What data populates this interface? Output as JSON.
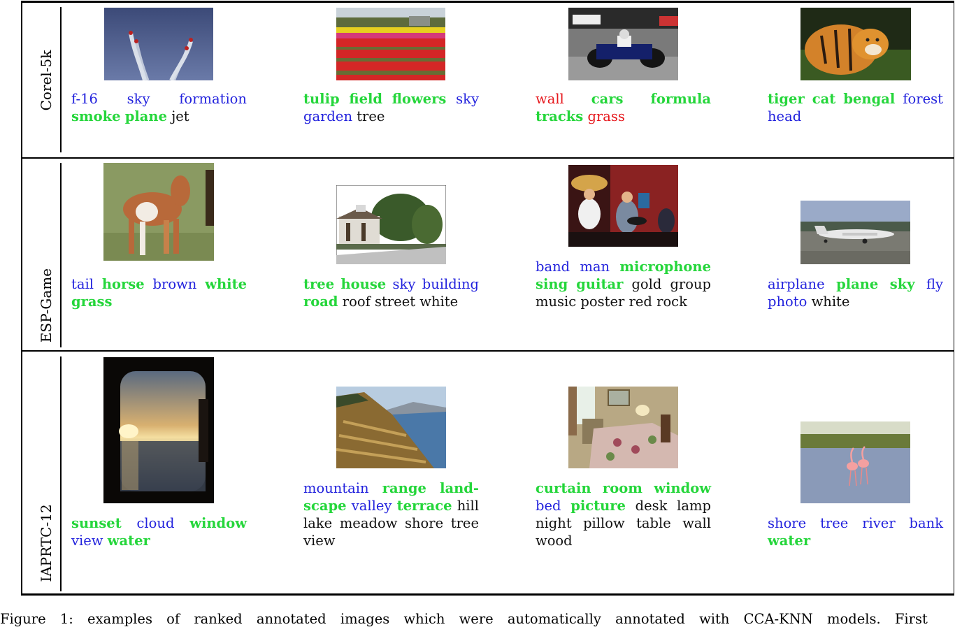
{
  "rows": [
    {
      "label": "Corel-5k",
      "cells": [
        {
          "image": "airshow-jets-photo",
          "tags": [
            {
              "text": "f-16",
              "status": "blue"
            },
            {
              "text": "sky",
              "status": "blue"
            },
            {
              "text": "formation",
              "status": "blue"
            },
            {
              "text": "smoke",
              "status": "green"
            },
            {
              "text": "plane",
              "status": "green"
            },
            {
              "text": "jet",
              "status": "black"
            }
          ]
        },
        {
          "image": "tulip-field-photo",
          "tags": [
            {
              "text": "tulip",
              "status": "green"
            },
            {
              "text": "field",
              "status": "green"
            },
            {
              "text": "flowers",
              "status": "green"
            },
            {
              "text": "sky",
              "status": "blue"
            },
            {
              "text": "garden",
              "status": "blue"
            },
            {
              "text": "tree",
              "status": "black"
            }
          ]
        },
        {
          "image": "formula-car-photo",
          "tags": [
            {
              "text": "wall",
              "status": "red"
            },
            {
              "text": "cars",
              "status": "green"
            },
            {
              "text": "formula",
              "status": "green"
            },
            {
              "text": "tracks",
              "status": "green"
            },
            {
              "text": "grass",
              "status": "red"
            }
          ]
        },
        {
          "image": "tiger-photo",
          "tags": [
            {
              "text": "tiger",
              "status": "green"
            },
            {
              "text": "cat",
              "status": "green"
            },
            {
              "text": "bengal",
              "status": "green"
            },
            {
              "text": "forest",
              "status": "blue"
            },
            {
              "text": "head",
              "status": "blue"
            }
          ]
        }
      ]
    },
    {
      "label": "ESP-Game",
      "cells": [
        {
          "image": "pony-photo",
          "tags": [
            {
              "text": "tail",
              "status": "blue"
            },
            {
              "text": "horse",
              "status": "green"
            },
            {
              "text": "brown",
              "status": "blue"
            },
            {
              "text": "white",
              "status": "green"
            },
            {
              "text": "grass",
              "status": "green"
            }
          ]
        },
        {
          "image": "house-trees-photo",
          "tags": [
            {
              "text": "tree",
              "status": "green"
            },
            {
              "text": "house",
              "status": "green"
            },
            {
              "text": "sky",
              "status": "blue"
            },
            {
              "text": "building",
              "status": "blue"
            },
            {
              "text": "road",
              "status": "green"
            },
            {
              "text": "roof",
              "status": "black"
            },
            {
              "text": "street",
              "status": "black"
            },
            {
              "text": "white",
              "status": "black"
            }
          ]
        },
        {
          "image": "band-stage-photo",
          "tags": [
            {
              "text": "band",
              "status": "blue"
            },
            {
              "text": "man",
              "status": "blue"
            },
            {
              "text": "microphone",
              "status": "green"
            },
            {
              "text": "sing",
              "status": "green"
            },
            {
              "text": "guitar",
              "status": "green"
            },
            {
              "text": "gold",
              "status": "black"
            },
            {
              "text": "group",
              "status": "black"
            },
            {
              "text": "music",
              "status": "black"
            },
            {
              "text": "poster",
              "status": "black"
            },
            {
              "text": "red",
              "status": "black"
            },
            {
              "text": "rock",
              "status": "black"
            }
          ]
        },
        {
          "image": "airplane-photo",
          "tags": [
            {
              "text": "airplane",
              "status": "blue"
            },
            {
              "text": "plane",
              "status": "green"
            },
            {
              "text": "sky",
              "status": "green"
            },
            {
              "text": "fly",
              "status": "blue"
            },
            {
              "text": "photo",
              "status": "blue"
            },
            {
              "text": "white",
              "status": "black"
            }
          ]
        }
      ]
    },
    {
      "label": "IAPRTC-12",
      "cells": [
        {
          "image": "sunset-window-photo",
          "tags": [
            {
              "text": "sunset",
              "status": "green"
            },
            {
              "text": "cloud",
              "status": "blue"
            },
            {
              "text": "window",
              "status": "green"
            },
            {
              "text": "view",
              "status": "blue"
            },
            {
              "text": "water",
              "status": "green"
            }
          ]
        },
        {
          "image": "lakeshore-photo",
          "tags": [
            {
              "text": "mountain",
              "status": "blue"
            },
            {
              "text": "range",
              "status": "green"
            },
            {
              "text": "land-",
              "status": "green"
            },
            {
              "text": "scape",
              "status": "green"
            },
            {
              "text": "valley",
              "status": "blue"
            },
            {
              "text": "terrace",
              "status": "green"
            },
            {
              "text": "hill",
              "status": "black"
            },
            {
              "text": "lake",
              "status": "black"
            },
            {
              "text": "meadow",
              "status": "black"
            },
            {
              "text": "shore",
              "status": "black"
            },
            {
              "text": "tree",
              "status": "black"
            },
            {
              "text": "view",
              "status": "black"
            }
          ]
        },
        {
          "image": "bedroom-photo",
          "tags": [
            {
              "text": "curtain",
              "status": "green"
            },
            {
              "text": "room",
              "status": "green"
            },
            {
              "text": "window",
              "status": "green"
            },
            {
              "text": "bed",
              "status": "blue"
            },
            {
              "text": "picture",
              "status": "green"
            },
            {
              "text": "desk",
              "status": "black"
            },
            {
              "text": "lamp",
              "status": "black"
            },
            {
              "text": "night",
              "status": "black"
            },
            {
              "text": "pillow",
              "status": "black"
            },
            {
              "text": "table",
              "status": "black"
            },
            {
              "text": "wall",
              "status": "black"
            },
            {
              "text": "wood",
              "status": "black"
            }
          ]
        },
        {
          "image": "flamingos-photo",
          "tags": [
            {
              "text": "shore",
              "status": "blue"
            },
            {
              "text": "tree",
              "status": "blue"
            },
            {
              "text": "river",
              "status": "blue"
            },
            {
              "text": "bank",
              "status": "blue"
            },
            {
              "text": "water",
              "status": "green"
            }
          ]
        }
      ]
    }
  ],
  "status_colors": {
    "green": "#25d63b",
    "blue": "#2222dd",
    "red": "#e6171c",
    "black": "#111111"
  },
  "figure_caption": "Figure 1: examples of ranked annotated images which were automatically annotated with CCA-KNN models. First"
}
